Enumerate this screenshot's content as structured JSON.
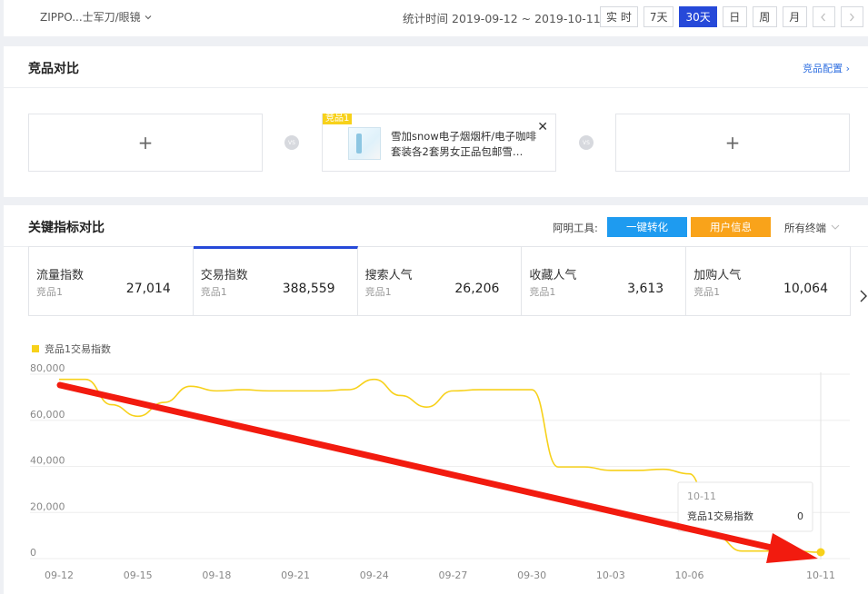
{
  "header": {
    "category": "ZIPPO...士军刀/眼镜",
    "stat_time_label": "统计时间",
    "stat_time_range": "2019-09-12 ~ 2019-10-11",
    "time_buttons": [
      "实 时",
      "7天",
      "30天",
      "日",
      "周",
      "月"
    ],
    "active_time_button": "30天"
  },
  "compare": {
    "title": "竞品对比",
    "config_link": "竞品配置",
    "add_symbol": "+",
    "vs": "VS",
    "product": {
      "tag": "竞品1",
      "name": "雪加snow电子烟烟杆/电子咖啡套装各2套男女正品包邮雪…"
    }
  },
  "metrics": {
    "title": "关键指标对比",
    "tools_label": "阿明工具:",
    "tool_convert": "一键转化",
    "tool_user_info": "用户信息",
    "terminal": "所有终端",
    "cards": [
      {
        "title": "流量指数",
        "sub": "竞品1",
        "value": "27,014"
      },
      {
        "title": "交易指数",
        "sub": "竞品1",
        "value": "388,559"
      },
      {
        "title": "搜索人气",
        "sub": "竞品1",
        "value": "26,206"
      },
      {
        "title": "收藏人气",
        "sub": "竞品1",
        "value": "3,613"
      },
      {
        "title": "加购人气",
        "sub": "竞品1",
        "value": "10,064"
      }
    ],
    "active_card": 1
  },
  "chart_data": {
    "type": "line",
    "legend": [
      "竞品1交易指数"
    ],
    "series_color": "#f7d11a",
    "x_ticks": [
      "09-12",
      "09-15",
      "09-18",
      "09-21",
      "09-24",
      "09-27",
      "09-30",
      "10-03",
      "10-06",
      "10-11"
    ],
    "y_ticks": [
      "80,000",
      "60,000",
      "40,000",
      "20,000",
      "0"
    ],
    "ylim": [
      0,
      80000
    ],
    "grid": true,
    "series": [
      {
        "name": "竞品1交易指数",
        "x": [
          "09-12",
          "09-13",
          "09-14",
          "09-15",
          "09-16",
          "09-17",
          "09-18",
          "09-19",
          "09-20",
          "09-21",
          "09-22",
          "09-23",
          "09-24",
          "09-25",
          "09-26",
          "09-27",
          "09-28",
          "09-29",
          "09-30",
          "10-01",
          "10-02",
          "10-03",
          "10-04",
          "10-05",
          "10-06",
          "10-07",
          "10-08",
          "10-09",
          "10-10",
          "10-11"
        ],
        "values": [
          75000,
          75000,
          64000,
          59000,
          65000,
          72000,
          70000,
          70500,
          70000,
          70000,
          70000,
          70500,
          75000,
          68000,
          63000,
          70000,
          70500,
          70500,
          70500,
          37000,
          37000,
          35500,
          35500,
          36000,
          34000,
          7000,
          500,
          500,
          500,
          0
        ]
      }
    ],
    "tooltip": {
      "date": "10-11",
      "label": "竞品1交易指数",
      "value": "0"
    },
    "annotation": "red arrow pointing from the series start down to the 10-11 point"
  }
}
